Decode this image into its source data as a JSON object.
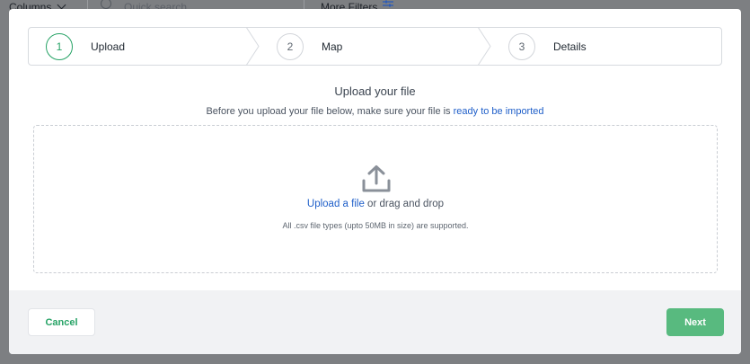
{
  "background": {
    "columns_label": "Columns",
    "search_placeholder": "Quick search",
    "more_filters_label": "More Filters"
  },
  "stepper": {
    "steps": [
      {
        "number": "1",
        "label": "Upload",
        "active": true
      },
      {
        "number": "2",
        "label": "Map",
        "active": false
      },
      {
        "number": "3",
        "label": "Details",
        "active": false
      }
    ]
  },
  "upload": {
    "title": "Upload your file",
    "subtitle_prefix": "Before you upload your file below, make sure your file is",
    "subtitle_link": "ready to be imported",
    "upload_link": "Upload a file",
    "upload_suffix": "or drag and drop",
    "hint": "All .csv file types (upto 50MB in size) are supported."
  },
  "footer": {
    "cancel_label": "Cancel",
    "next_label": "Next"
  },
  "colors": {
    "accent_green": "#27a366",
    "next_button_green": "#58ba7f",
    "link_blue": "#1f5fc9"
  },
  "icons": {
    "upload": "upload-arrow-icon",
    "step_separator": "chevron-right-icon",
    "background_search": "search-icon",
    "background_filter": "filter-sliders-icon",
    "background_chevron": "chevron-down-icon"
  }
}
